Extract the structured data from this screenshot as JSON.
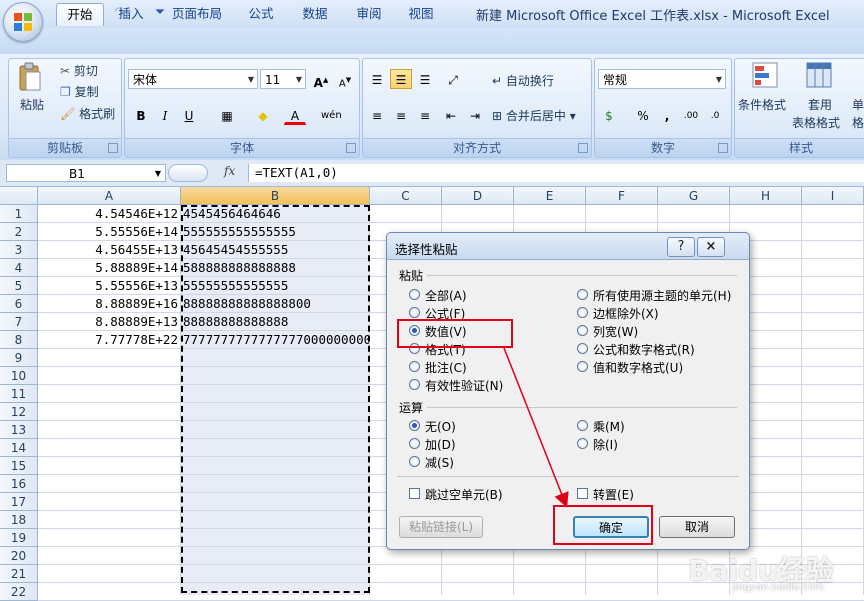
{
  "window": {
    "title": "新建 Microsoft Office Excel 工作表.xlsx - Microsoft Excel",
    "qat_icons": [
      "save-icon",
      "undo-icon",
      "redo-icon",
      "customize-qat-icon"
    ]
  },
  "tabs": [
    "开始",
    "插入",
    "页面布局",
    "公式",
    "数据",
    "审阅",
    "视图"
  ],
  "active_tab": "开始",
  "ribbon": {
    "clipboard": {
      "label": "剪贴板",
      "paste": "粘贴",
      "cut": "剪切",
      "copy": "复制",
      "format_painter": "格式刷"
    },
    "font": {
      "label": "字体",
      "font_name": "宋体",
      "font_size": "11",
      "bold": "B",
      "italic": "I",
      "underline": "U",
      "grow": "A",
      "shrink": "A",
      "wen": "wén",
      "font_color_glyph": "A"
    },
    "alignment": {
      "label": "对齐方式",
      "wrap_text": "自动换行",
      "merge_center": "合并后居中"
    },
    "number": {
      "label": "数字",
      "format": "常规",
      "percent": "%",
      "comma": ",",
      "inc_decimal": ".00",
      "dec_decimal": ".0"
    },
    "styles": {
      "label": "样式",
      "conditional": "条件格式",
      "table_format_1": "套用",
      "table_format_2": "表格格式",
      "cell_styles_1": "单",
      "cell_styles_2": "格"
    }
  },
  "formula_bar": {
    "name_box": "B1",
    "fx": "fx",
    "formula": "=TEXT(A1,0)"
  },
  "grid": {
    "columns": [
      "A",
      "B",
      "C",
      "D",
      "E",
      "F",
      "G",
      "H",
      "I"
    ],
    "rows": [
      "1",
      "2",
      "3",
      "4",
      "5",
      "6",
      "7",
      "8",
      "9",
      "10",
      "11",
      "12",
      "13",
      "14",
      "15",
      "16",
      "17",
      "18",
      "19",
      "20",
      "21",
      "22"
    ],
    "colA": [
      "4.54546E+12",
      "5.55556E+14",
      "4.56455E+13",
      "5.88889E+14",
      "5.55556E+13",
      "8.88889E+16",
      "8.88889E+13",
      "7.77778E+22"
    ],
    "colB": [
      "4545456464646",
      "555555555555555",
      "45645454555555",
      "588888888888888",
      "55555555555555",
      "88888888888888800",
      "88888888888888",
      "7777777777777777000000000"
    ]
  },
  "dialog": {
    "title": "选择性粘贴",
    "help": "?",
    "close": "×",
    "paste_section": "粘贴",
    "paste_options_left": [
      "全部(A)",
      "公式(F)",
      "数值(V)",
      "格式(T)",
      "批注(C)",
      "有效性验证(N)"
    ],
    "paste_options_right": [
      "所有使用源主题的单元(H)",
      "边框除外(X)",
      "列宽(W)",
      "公式和数字格式(R)",
      "值和数字格式(U)"
    ],
    "selected_paste": "数值(V)",
    "operation_section": "运算",
    "operation_left": [
      "无(O)",
      "加(D)",
      "减(S)"
    ],
    "operation_right": [
      "乘(M)",
      "除(I)"
    ],
    "selected_operation": "无(O)",
    "skip_blanks": "跳过空单元(B)",
    "transpose": "转置(E)",
    "paste_link": "粘贴链接(L)",
    "ok": "确定",
    "cancel": "取消"
  },
  "watermark": {
    "brand": "Baidu经验",
    "url": "jingyan.baidu.com"
  },
  "colors": {
    "annotation_red": "#e0001a",
    "ribbon_blue": "#dbe8f7",
    "selected_col": "#e8ecf6"
  }
}
